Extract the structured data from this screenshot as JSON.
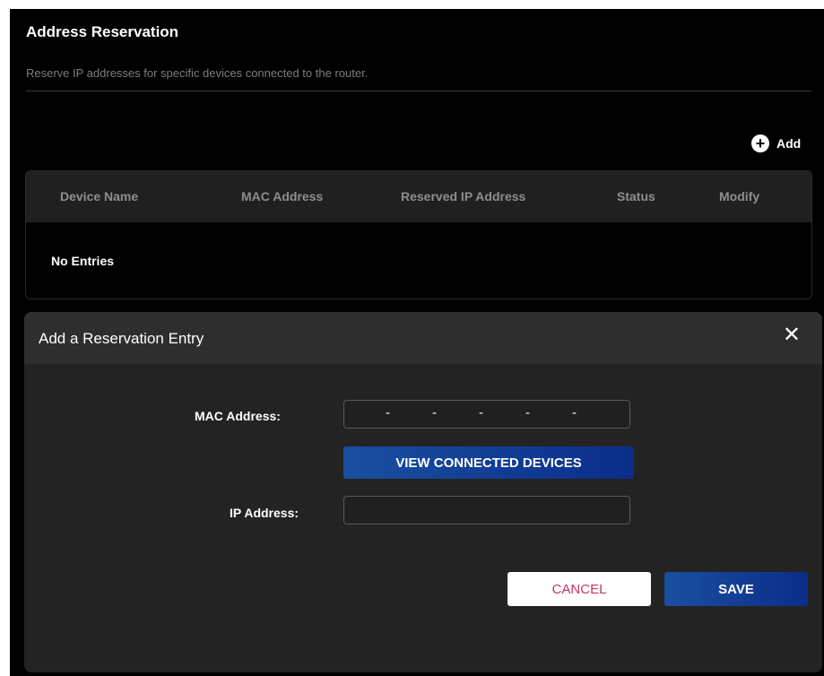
{
  "section": {
    "title": "Address Reservation",
    "description": "Reserve IP addresses for specific devices connected to the router."
  },
  "toolbar": {
    "add_label": "Add",
    "add_icon": "plus-circle-icon"
  },
  "table": {
    "columns": [
      "Device Name",
      "MAC Address",
      "Reserved IP Address",
      "Status",
      "Modify"
    ],
    "empty_text": "No Entries"
  },
  "modal": {
    "title": "Add a Reservation Entry",
    "close_icon": "close-icon",
    "mac_label": "MAC Address:",
    "mac_separator": "-",
    "mac_value": "",
    "view_devices_label": "VIEW CONNECTED DEVICES",
    "ip_label": "IP Address:",
    "ip_value": "",
    "cancel_label": "CANCEL",
    "save_label": "SAVE"
  },
  "colors": {
    "background": "#000000",
    "modal": "#232323",
    "accent": "#1a4fa0",
    "cancel_text": "#c7336c"
  }
}
